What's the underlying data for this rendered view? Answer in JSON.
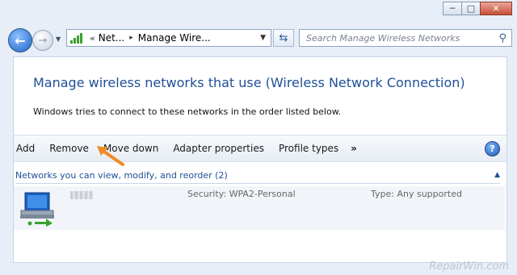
{
  "window": {
    "buttons": {
      "minimize": "─",
      "maximize": "□",
      "close": "✕"
    }
  },
  "nav": {
    "back_icon": "back-arrow-icon",
    "forward_icon": "forward-arrow-icon",
    "breadcrumb": {
      "overflow": "«",
      "items": [
        "Net...",
        "Manage Wire..."
      ],
      "separator": "▸"
    },
    "refresh_icon": "refresh-icon",
    "search": {
      "placeholder": "Search Manage Wireless Networks"
    }
  },
  "main": {
    "heading": "Manage wireless networks that use (Wireless Network Connection)",
    "description": "Windows tries to connect to these networks in the order listed below."
  },
  "toolbar": {
    "items": [
      "Add",
      "Remove",
      "Move down",
      "Adapter properties",
      "Profile types"
    ],
    "more": "»",
    "help": "?"
  },
  "networks": {
    "group_header": "Networks you can view, modify, and reorder (2)",
    "rows": [
      {
        "security": "Security:  WPA2-Personal",
        "type": "Type:  Any supported"
      }
    ]
  },
  "colors": {
    "heading": "#1e4f96",
    "arrow": "#f08a24"
  },
  "watermark": "RepairWin.com"
}
